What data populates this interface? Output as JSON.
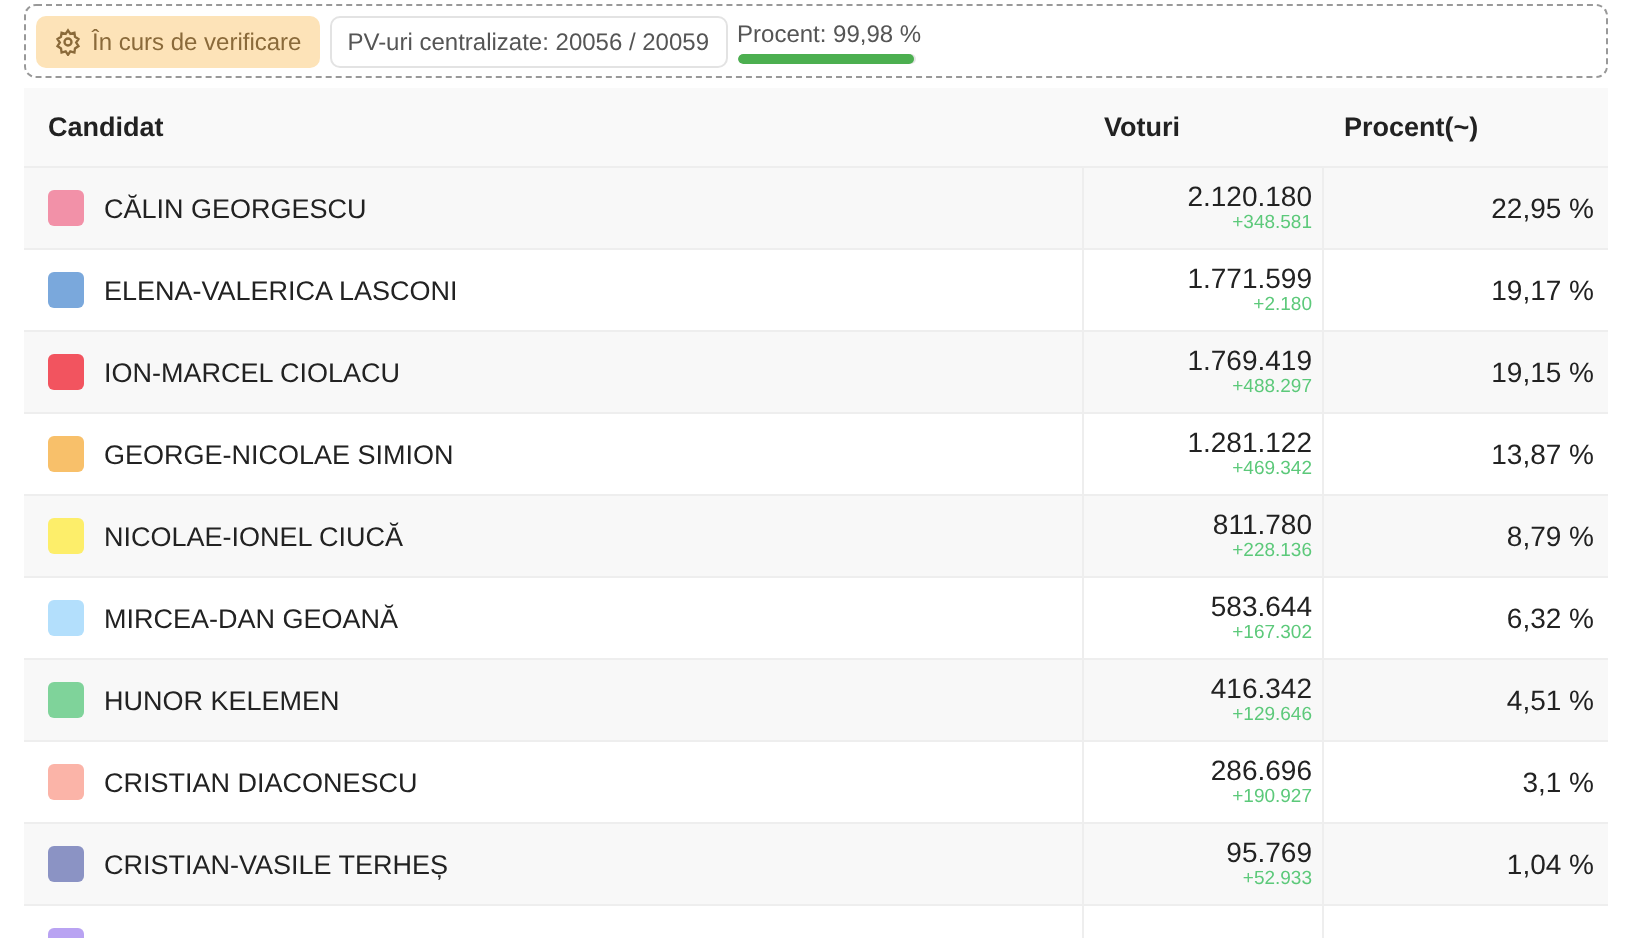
{
  "status": {
    "badge": "În curs de verificare",
    "counter": "PV-uri centralizate: 20056 / 20059",
    "progress_label": "Procent: 99,98 %",
    "level": 0.9998
  },
  "table": {
    "columns": [
      "Candidat",
      "Voturi",
      "Procent(~)"
    ],
    "rows": [
      {
        "color": "#f291a8",
        "name": "CĂLIN GEORGESCU",
        "votes": "2.120.180",
        "delta": "+348.581",
        "percent": "22,95 %"
      },
      {
        "color": "#7aa8dc",
        "name": "ELENA-VALERICA LASCONI",
        "votes": "1.771.599",
        "delta": "+2.180",
        "percent": "19,17 %"
      },
      {
        "color": "#f2545f",
        "name": "ION-MARCEL CIOLACU",
        "votes": "1.769.419",
        "delta": "+488.297",
        "percent": "19,15 %"
      },
      {
        "color": "#f8c06a",
        "name": "GEORGE-NICOLAE SIMION",
        "votes": "1.281.122",
        "delta": "+469.342",
        "percent": "13,87 %"
      },
      {
        "color": "#fdee6a",
        "name": "NICOLAE-IONEL CIUCĂ",
        "votes": "811.780",
        "delta": "+228.136",
        "percent": "8,79 %"
      },
      {
        "color": "#b3dffc",
        "name": "MIRCEA-DAN GEOANĂ",
        "votes": "583.644",
        "delta": "+167.302",
        "percent": "6,32 %"
      },
      {
        "color": "#7fd39a",
        "name": "HUNOR KELEMEN",
        "votes": "416.342",
        "delta": "+129.646",
        "percent": "4,51 %"
      },
      {
        "color": "#fbb4a8",
        "name": "CRISTIAN DIACONESCU",
        "votes": "286.696",
        "delta": "+190.927",
        "percent": "3,1 %"
      },
      {
        "color": "#8b93c4",
        "name": "CRISTIAN-VASILE TERHEȘ",
        "votes": "95.769",
        "delta": "+52.933",
        "percent": "1,04 %"
      },
      {
        "color": "#b9a3f2"
      }
    ]
  }
}
